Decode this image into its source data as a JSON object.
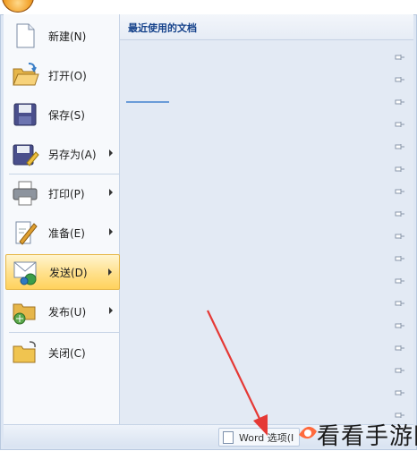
{
  "menu": {
    "items": [
      {
        "label": "新建(N)",
        "icon": "new-document-icon",
        "has_submenu": false
      },
      {
        "label": "打开(O)",
        "icon": "open-folder-icon",
        "has_submenu": false
      },
      {
        "label": "保存(S)",
        "icon": "save-disk-icon",
        "has_submenu": false
      },
      {
        "label": "另存为(A)",
        "icon": "save-as-icon",
        "has_submenu": true
      },
      {
        "label": "打印(P)",
        "icon": "printer-icon",
        "has_submenu": true
      },
      {
        "label": "准备(E)",
        "icon": "prepare-pen-icon",
        "has_submenu": true
      },
      {
        "label": "发送(D)",
        "icon": "send-icon",
        "has_submenu": true,
        "highlighted": true
      },
      {
        "label": "发布(U)",
        "icon": "publish-icon",
        "has_submenu": true
      },
      {
        "label": "关闭(C)",
        "icon": "close-folder-icon",
        "has_submenu": false
      }
    ]
  },
  "recent": {
    "title": "最近使用的文档"
  },
  "bottom": {
    "word_options_label": "Word 选项(I"
  },
  "watermark": {
    "text": "看看手游网"
  },
  "colors": {
    "highlight": "#ffd25c",
    "title_blue": "#15428b",
    "annotation_red": "#e53935"
  }
}
